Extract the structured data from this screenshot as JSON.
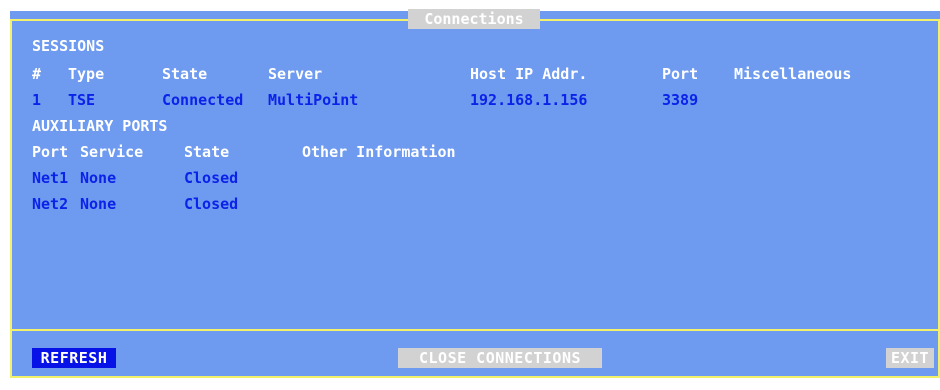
{
  "window": {
    "title": "Connections"
  },
  "sessions": {
    "heading": "SESSIONS",
    "columns": [
      "#",
      "Type",
      "State",
      "Server",
      "Host IP Addr.",
      "Port",
      "Miscellaneous"
    ],
    "rows": [
      {
        "num": "1",
        "type": "TSE",
        "state": "Connected",
        "server": "MultiPoint",
        "host_ip": "192.168.1.156",
        "port": "3389",
        "misc": ""
      }
    ]
  },
  "aux_ports": {
    "heading": "AUXILIARY PORTS",
    "columns": [
      "Port",
      "Service",
      "State",
      "Other Information"
    ],
    "rows": [
      {
        "port": "Net1",
        "service": "None",
        "state": "Closed",
        "other": ""
      },
      {
        "port": "Net2",
        "service": "None",
        "state": "Closed",
        "other": ""
      }
    ]
  },
  "buttons": {
    "refresh": "REFRESH",
    "close_connections": "CLOSE CONNECTIONS",
    "exit": "EXIT"
  },
  "colors": {
    "background": "#6e9bf0",
    "frame": "#f3f06a",
    "value_text": "#0b22e8",
    "label_text": "#ffffff",
    "active_button": "#0712e6",
    "inactive_button": "#d2d2d2"
  }
}
